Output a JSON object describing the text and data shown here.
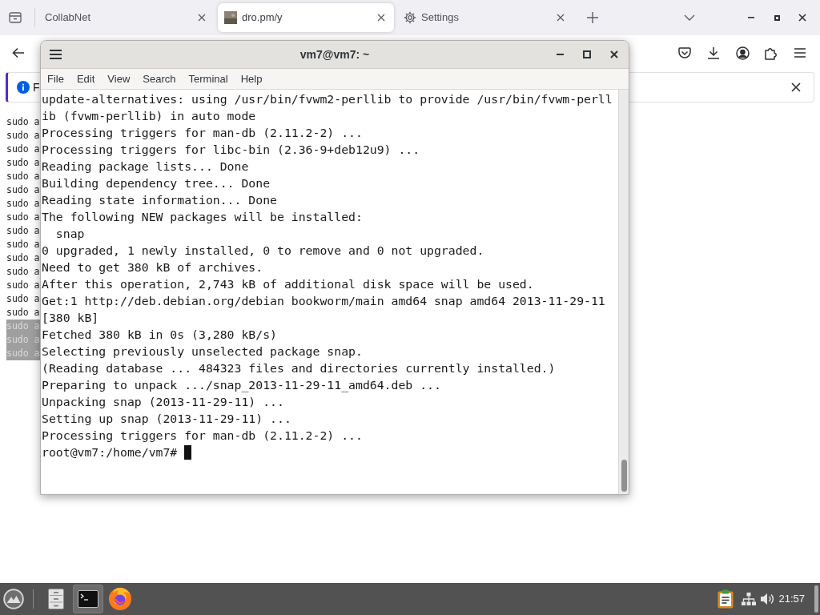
{
  "browser": {
    "tabs": [
      {
        "label": "CollabNet",
        "kind": "plain",
        "selected": false
      },
      {
        "label": "dro.pm/y",
        "kind": "favicon",
        "selected": true
      },
      {
        "label": "Settings",
        "kind": "settings",
        "selected": false
      }
    ],
    "notification": {
      "text": "F"
    },
    "page_lines": [
      {
        "text": "sudo a",
        "selected": false
      },
      {
        "text": "sudo a",
        "selected": false
      },
      {
        "text": "sudo a",
        "selected": false
      },
      {
        "text": "sudo a",
        "selected": false
      },
      {
        "text": "sudo a",
        "selected": false
      },
      {
        "text": "sudo a",
        "selected": false
      },
      {
        "text": "sudo a",
        "selected": false
      },
      {
        "text": "sudo a",
        "selected": false
      },
      {
        "text": "sudo a",
        "selected": false
      },
      {
        "text": "sudo a",
        "selected": false
      },
      {
        "text": "sudo a",
        "selected": false
      },
      {
        "text": "sudo a",
        "selected": false
      },
      {
        "text": "sudo a",
        "selected": false
      },
      {
        "text": "sudo a",
        "selected": false
      },
      {
        "text": "sudo a",
        "selected": false
      },
      {
        "text": "sudo a",
        "selected": true
      },
      {
        "text": "sudo a",
        "selected": true
      },
      {
        "text": "sudo a",
        "selected": true
      }
    ]
  },
  "terminal": {
    "title": "vm7@vm7: ~",
    "menu": [
      "File",
      "Edit",
      "View",
      "Search",
      "Terminal",
      "Help"
    ],
    "lines": [
      "update-alternatives: using /usr/bin/fvwm2-perllib to provide /usr/bin/fvwm-perll",
      "ib (fvwm-perllib) in auto mode",
      "Processing triggers for man-db (2.11.2-2) ...",
      "Processing triggers for libc-bin (2.36-9+deb12u9) ...",
      "Reading package lists... Done",
      "Building dependency tree... Done",
      "Reading state information... Done",
      "The following NEW packages will be installed:",
      "  snap",
      "0 upgraded, 1 newly installed, 0 to remove and 0 not upgraded.",
      "Need to get 380 kB of archives.",
      "After this operation, 2,743 kB of additional disk space will be used.",
      "Get:1 http://deb.debian.org/debian bookworm/main amd64 snap amd64 2013-11-29-11",
      "[380 kB]",
      "Fetched 380 kB in 0s (3,280 kB/s)",
      "Selecting previously unselected package snap.",
      "(Reading database ... 484323 files and directories currently installed.)",
      "Preparing to unpack .../snap_2013-11-29-11_amd64.deb ...",
      "Unpacking snap (2013-11-29-11) ...",
      "Setting up snap (2013-11-29-11) ...",
      "Processing triggers for man-db (2.11.2-2) ..."
    ],
    "prompt": "root@vm7:/home/vm7#"
  },
  "taskbar": {
    "apps": [
      {
        "kind": "files",
        "selected": false
      },
      {
        "kind": "terminal",
        "selected": true
      },
      {
        "kind": "browser",
        "selected": false
      }
    ],
    "clock": "21:57"
  }
}
